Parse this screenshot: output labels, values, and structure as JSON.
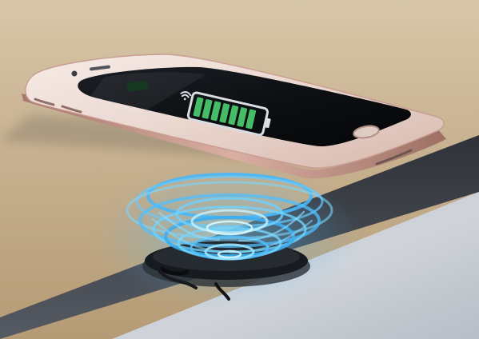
{
  "scene": {
    "subject": "smartphone-floating-above-wireless-charger",
    "battery": {
      "icon": "battery-charging-icon",
      "filled_bars": 7,
      "total_bars": 7,
      "level_fraction": 0.9
    },
    "colors": {
      "tabletop": "#c9b596",
      "table_edge_shadow": "#4a4e57",
      "floor": "#c8ccd2",
      "phone_body": "#ead7cf",
      "phone_rim": "#c59284",
      "screen": "#0d0f12",
      "battery_outline": "#d9dde2",
      "battery_fill": "#49c76d",
      "charging_wave": "#54c4ff",
      "charger_pad": "#171a1f"
    },
    "icons": [
      "camera-icon",
      "speaker-icon",
      "home-button-icon",
      "charging-port-icon",
      "volume-button-icon",
      "wireless-charging-wave-icon"
    ]
  }
}
